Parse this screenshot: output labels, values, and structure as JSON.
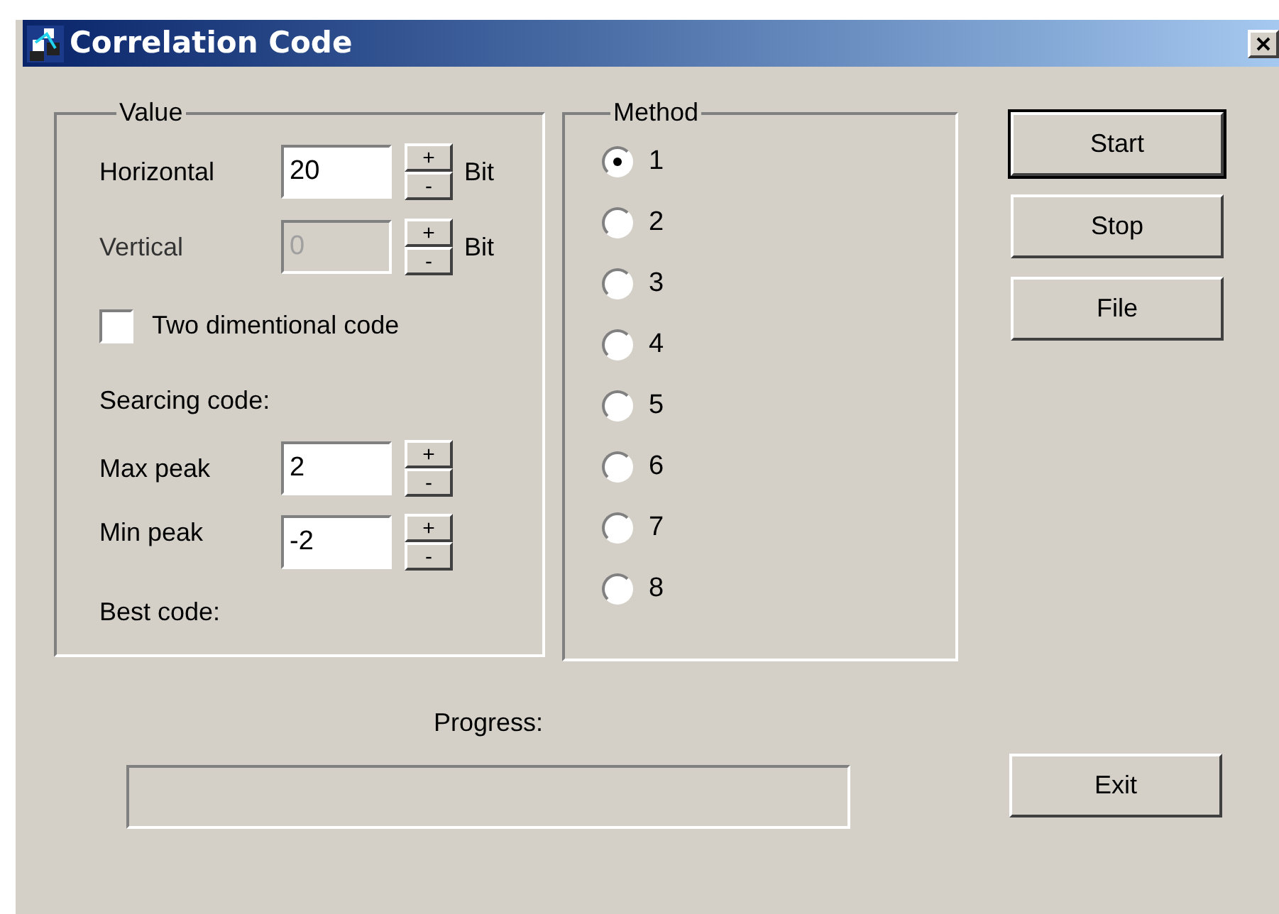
{
  "window": {
    "title": "Correlation Code"
  },
  "value_group": {
    "title": "Value",
    "fields": [
      {
        "label": "Horizontal",
        "value": "20",
        "unit": "Bit",
        "disabled": false
      },
      {
        "label": "Vertical",
        "value": "0",
        "unit": "Bit",
        "disabled": true
      }
    ],
    "two_dimensional": {
      "label": "Two dimentional code",
      "checked": false
    },
    "searching_label": "Searcing code:",
    "peaks": [
      {
        "label": "Max peak",
        "value": "2"
      },
      {
        "label": "Min peak",
        "value": "-2"
      }
    ],
    "best_code_label": "Best code:"
  },
  "spin_up": "+",
  "spin_down": "-",
  "method_group": {
    "title": "Method",
    "options": [
      {
        "label": "1",
        "selected": true
      },
      {
        "label": "2",
        "selected": false
      },
      {
        "label": "3",
        "selected": false
      },
      {
        "label": "4",
        "selected": false
      },
      {
        "label": "5",
        "selected": false
      },
      {
        "label": "6",
        "selected": false
      },
      {
        "label": "7",
        "selected": false
      },
      {
        "label": "8",
        "selected": false
      }
    ]
  },
  "buttons": [
    {
      "label": "Start",
      "default": true
    },
    {
      "label": "Stop",
      "default": false
    },
    {
      "label": "File",
      "default": false
    }
  ],
  "progress": {
    "label": "Progress:",
    "level": 0
  },
  "exit_button": {
    "label": "Exit"
  }
}
